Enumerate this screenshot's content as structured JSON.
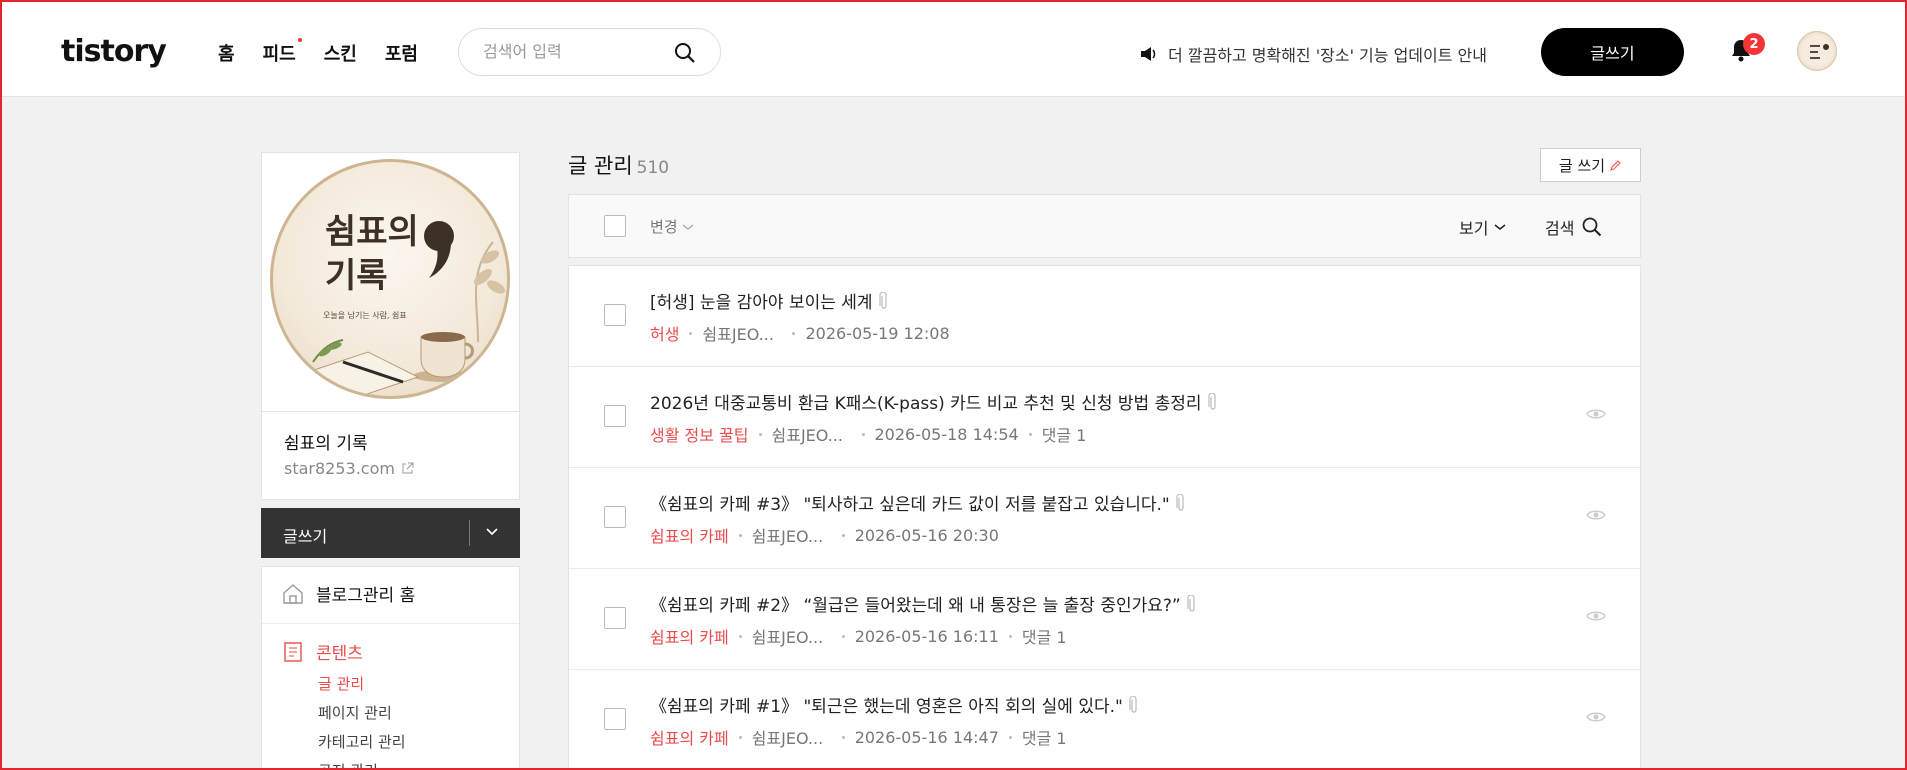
{
  "header": {
    "logo": "tistory",
    "nav": [
      "홈",
      "피드",
      "스킨",
      "포럼"
    ],
    "search_placeholder": "검색어 입력",
    "notice": "더 깔끔하고 명확해진 '장소' 기능 업데이트 안내",
    "write_label": "글쓰기",
    "notification_count": "2"
  },
  "sidebar": {
    "blog_image_title_line1": "쉼표의",
    "blog_image_title_line2": "기록",
    "blog_image_subtitle": "오늘을 남기는 사람, 쉼표",
    "blog_name": "쉼표의 기록",
    "blog_url": "star8253.com",
    "write_label": "글쓰기",
    "menu": {
      "home": "블로그관리 홈",
      "contents": "콘텐츠",
      "sub_items": [
        "글 관리",
        "페이지 관리",
        "카테고리 관리",
        "공지 관리"
      ]
    }
  },
  "main": {
    "title": "글 관리",
    "count": "510",
    "write_label": "글 쓰기",
    "toolbar": {
      "change": "변경",
      "view": "보기",
      "search": "검색"
    },
    "posts": [
      {
        "title": "[허생] 눈을 감아야 보이는 세계",
        "category": "허생",
        "author": "쉼표JEO...",
        "date": "2026-05-19 12:08",
        "comments": "",
        "eye": false
      },
      {
        "title": "2026년 대중교통비 환급 K패스(K-pass) 카드 비교 추천 및 신청 방법 총정리",
        "category": "생활 정보 꿀팁",
        "author": "쉼표JEO...",
        "date": "2026-05-18 14:54",
        "comments": "댓글 1",
        "eye": true
      },
      {
        "title": "《쉼표의 카페 #3》 \"퇴사하고 싶은데 카드 값이 저를 붙잡고 있습니다.\"",
        "category": "쉼표의 카페",
        "author": "쉼표JEO...",
        "date": "2026-05-16 20:30",
        "comments": "",
        "eye": true
      },
      {
        "title": "《쉼표의 카페 #2》 “월급은 들어왔는데 왜 내 통장은 늘 출장 중인가요?”",
        "category": "쉼표의 카페",
        "author": "쉼표JEO...",
        "date": "2026-05-16 16:11",
        "comments": "댓글 1",
        "eye": true
      },
      {
        "title": "《쉼표의 카페 #1》 \"퇴근은 했는데 영혼은 아직 회의 실에 있다.\"",
        "category": "쉼표의 카페",
        "author": "쉼표JEO...",
        "date": "2026-05-16 14:47",
        "comments": "댓글 1",
        "eye": true
      }
    ]
  },
  "colors": {
    "accent": "#e94c4c",
    "dark": "#333333",
    "badge": "#f53535"
  }
}
